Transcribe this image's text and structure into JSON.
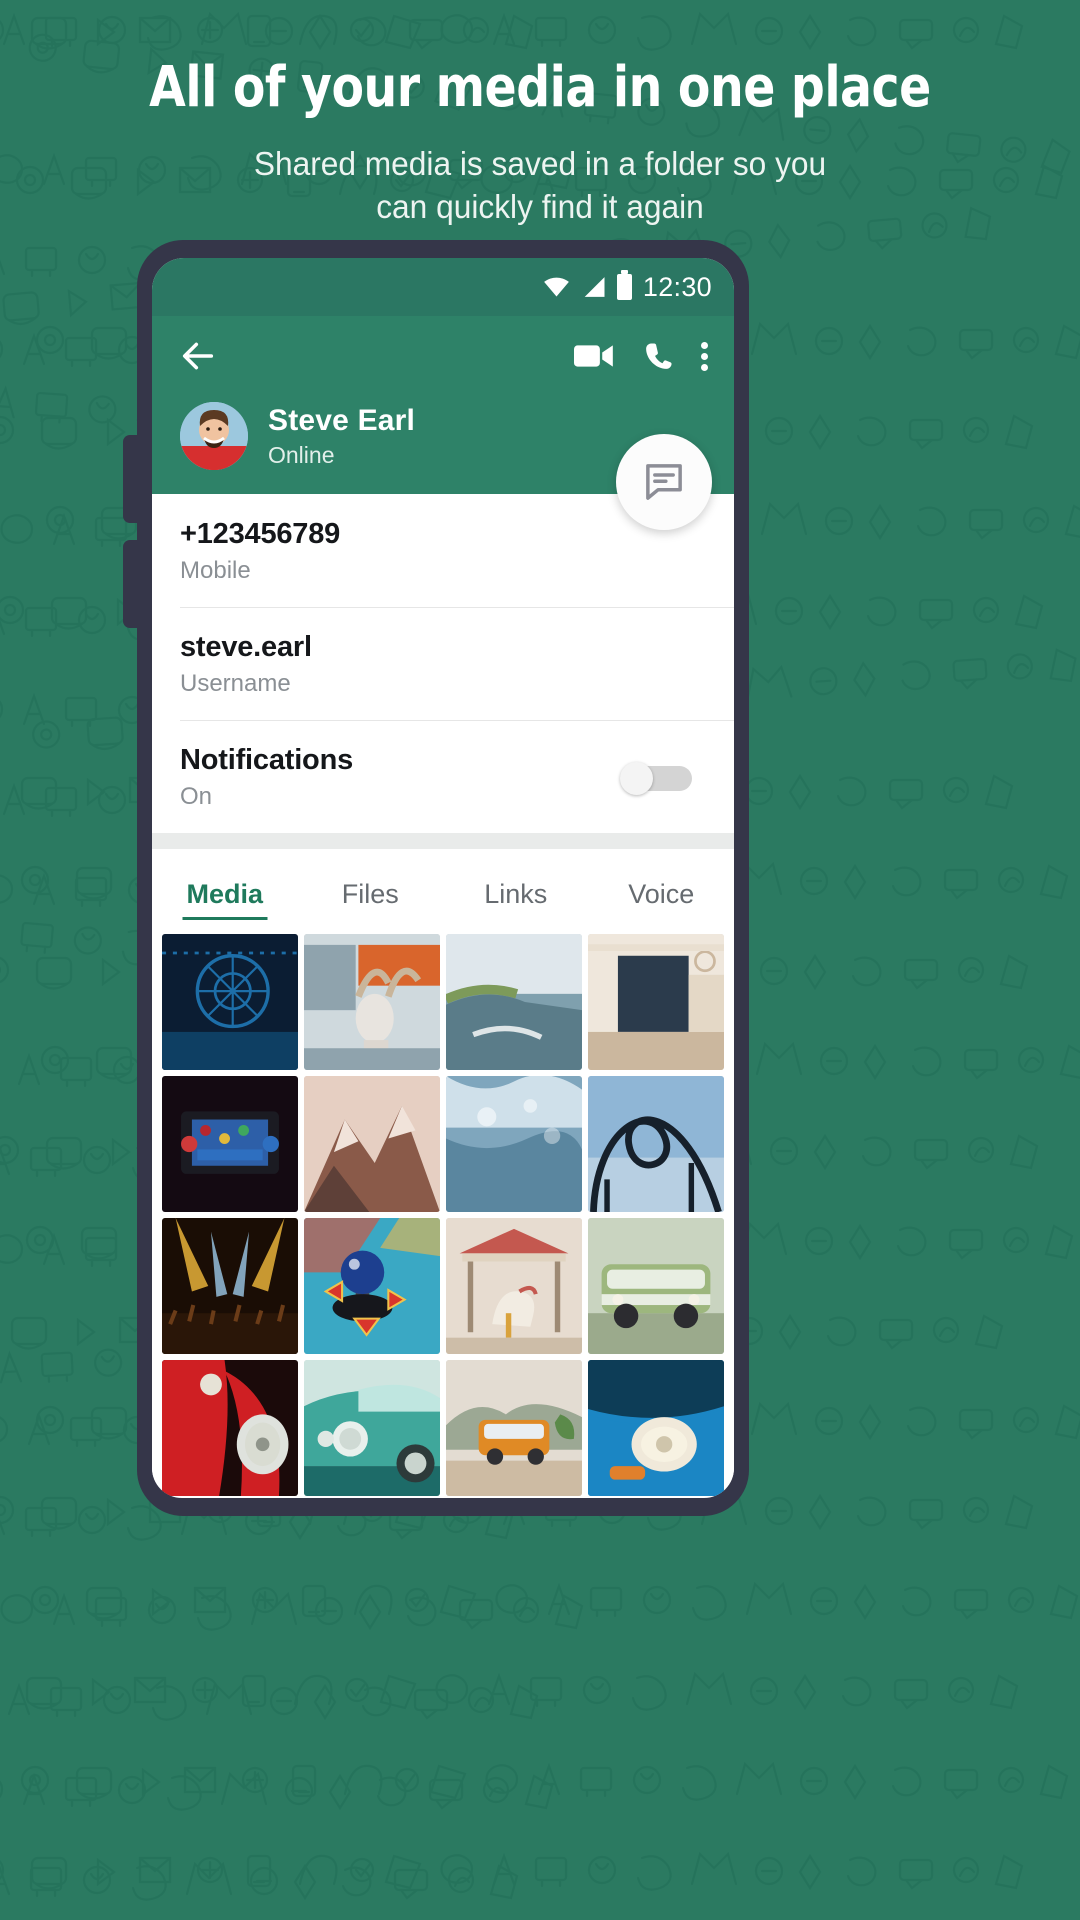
{
  "promo": {
    "title": "All of your media in one place",
    "subtitle_line1": "Shared media is saved in a folder so you",
    "subtitle_line2": "can quickly find it again"
  },
  "colors": {
    "background_green": "#2C7A62",
    "appbar_green": "#2E8268",
    "statusbar_green": "#2B7763",
    "phone_frame": "#353649",
    "accent_green": "#1F7A5C",
    "card_white": "#FFFFFF"
  },
  "statusbar": {
    "time": "12:30",
    "icons": [
      "wifi-icon",
      "signal-icon",
      "battery-icon"
    ]
  },
  "appbar": {
    "back_icon": "back-arrow-icon",
    "actions": [
      {
        "name": "video-call-icon",
        "label": "Video call"
      },
      {
        "name": "voice-call-icon",
        "label": "Call"
      },
      {
        "name": "overflow-menu-icon",
        "label": "More options"
      }
    ],
    "contact": {
      "name": "Steve Earl",
      "status": "Online",
      "avatar": "contact-avatar"
    }
  },
  "fab": {
    "icon": "chat-bubble-icon",
    "label": "Message"
  },
  "info_rows": [
    {
      "value": "+123456789",
      "label": "Mobile",
      "type": "phone"
    },
    {
      "value": "steve.earl",
      "label": "Username",
      "type": "username"
    },
    {
      "value": "Notifications",
      "label": "On",
      "type": "toggle",
      "toggle_state": "off"
    }
  ],
  "tabs": [
    {
      "label": "Media",
      "active": true
    },
    {
      "label": "Files",
      "active": false
    },
    {
      "label": "Links",
      "active": false
    },
    {
      "label": "Voice",
      "active": false
    }
  ],
  "media_grid": {
    "columns": 4,
    "items": [
      {
        "name": "ferris-wheel-night",
        "c1": "#0b1d33",
        "c2": "#1d6ea8",
        "c3": "#0e3f63",
        "kind": "ferris"
      },
      {
        "name": "deer-street-scene",
        "c1": "#cfd9dd",
        "c2": "#d9652c",
        "c3": "#8fa3ad",
        "kind": "street"
      },
      {
        "name": "coastal-cliff-sea",
        "c1": "#dfe7ec",
        "c2": "#7fa0ae",
        "c3": "#5a7c89",
        "kind": "coast"
      },
      {
        "name": "living-room-interior",
        "c1": "#efe7dc",
        "c2": "#2b3b4c",
        "c3": "#cbb79e",
        "kind": "room"
      },
      {
        "name": "handheld-console",
        "c1": "#140a12",
        "c2": "#b8272f",
        "c3": "#2d5fa8",
        "kind": "console"
      },
      {
        "name": "mountain-peak-dusk",
        "c1": "#e6cfc2",
        "c2": "#8a5a49",
        "c3": "#5e4038",
        "kind": "mountain"
      },
      {
        "name": "water-surface-blur",
        "c1": "#cfe0ea",
        "c2": "#7fa6bd",
        "c3": "#4d7b95",
        "kind": "water"
      },
      {
        "name": "rollercoaster-loop",
        "c1": "#8fb6d6",
        "c2": "#16202b",
        "c3": "#b7cfe2",
        "kind": "coaster"
      },
      {
        "name": "concert-stage-lights",
        "c1": "#1a0d05",
        "c2": "#e8b23a",
        "c3": "#9cc9e8",
        "kind": "concert"
      },
      {
        "name": "arcade-joystick",
        "c1": "#3aa8c4",
        "c2": "#1d3f8f",
        "c3": "#e24b32",
        "kind": "joystick"
      },
      {
        "name": "carousel-horses",
        "c1": "#cdbda8",
        "c2": "#e7dcd0",
        "c3": "#9e8a74",
        "kind": "carousel"
      },
      {
        "name": "green-vw-van",
        "c1": "#c9d4c0",
        "c2": "#9db77e",
        "c3": "#6d8057",
        "kind": "van-green"
      },
      {
        "name": "red-car-headlight",
        "c1": "#1b0a0a",
        "c2": "#cf1f23",
        "c3": "#dfe2dd",
        "kind": "car-red"
      },
      {
        "name": "teal-classic-car",
        "c1": "#cfe5e0",
        "c2": "#3fa79b",
        "c3": "#1d6b68",
        "kind": "car-teal"
      },
      {
        "name": "orange-van-mountains",
        "c1": "#e3dcd2",
        "c2": "#e08a25",
        "c3": "#8a9b84",
        "kind": "van-orange"
      },
      {
        "name": "blue-car-headlight",
        "c1": "#0d3d57",
        "c2": "#1b86c4",
        "c3": "#f0e9da",
        "kind": "car-blue"
      }
    ]
  }
}
